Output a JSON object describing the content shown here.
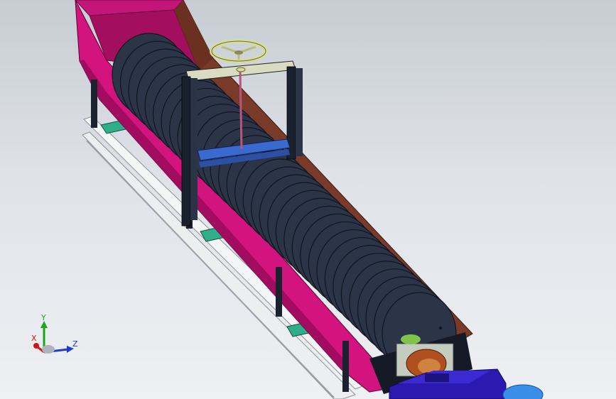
{
  "viewport": {
    "background_top": "#c7ccd3",
    "background_bottom": "#eef0f3"
  },
  "model": {
    "colors": {
      "trough": "#d4147e",
      "trough_dark": "#8a0a52",
      "hopper": "#7a3a2a",
      "flight": "#2c3447",
      "flight_edge": "#10151f",
      "frame": "#1a2230",
      "frame_light": "#d9dcc0",
      "handwheel": "#d8dc9a",
      "crossbar": "#3a6ad0",
      "rail": "#f4f5f6",
      "rail_shadow": "#8d9299",
      "teal": "#2fae8a",
      "motor": "#2a1ab0",
      "motor_light": "#3a8ee8",
      "bearing": "#b0501e",
      "bracket": "#c4ccc0"
    },
    "flight_count": 34
  },
  "triad": {
    "x_label": "X",
    "y_label": "Y",
    "z_label": "Z",
    "x_color": "#d01515",
    "y_color": "#1aa51a",
    "z_color": "#1c3ccf"
  }
}
